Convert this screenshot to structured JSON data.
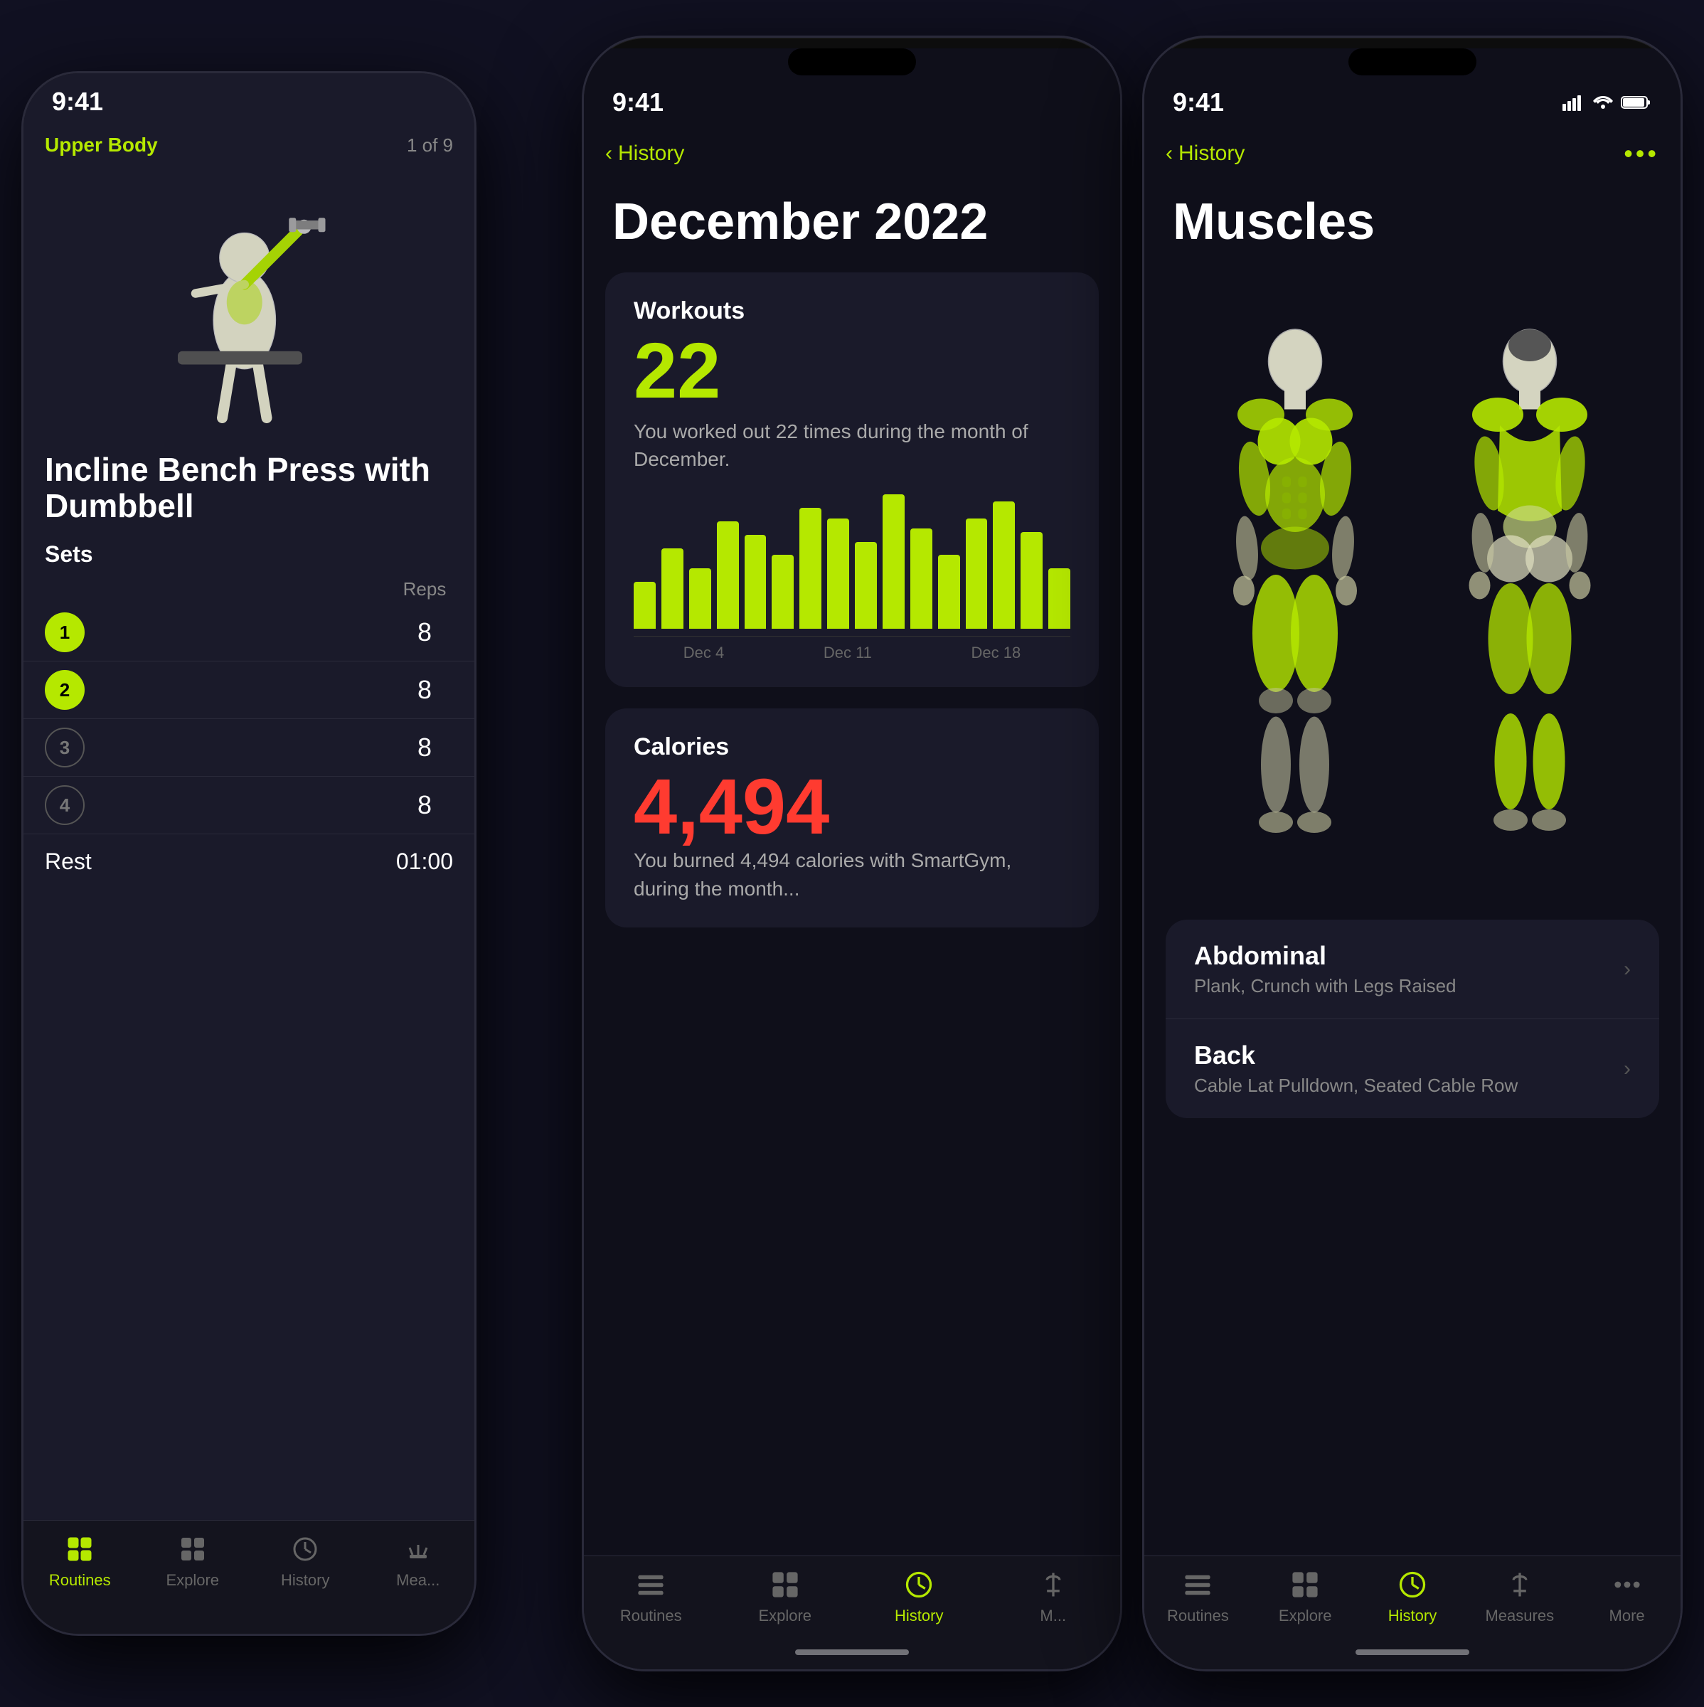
{
  "app": {
    "name": "SmartGym",
    "accent_color": "#b5e800",
    "background": "#0f0f1a"
  },
  "status_bar": {
    "time": "9:41",
    "signal": "●●●",
    "wifi": "wifi",
    "battery": "battery"
  },
  "left_phone": {
    "header": {
      "title": "Upper Body",
      "counter": "1 of 9"
    },
    "exercise_name": "Incline Bench Press with Dumbbell",
    "sets_label": "Sets",
    "reps_label": "Reps",
    "sets": [
      {
        "number": "1",
        "reps": "8",
        "active": true
      },
      {
        "number": "2",
        "reps": "8",
        "active": true
      },
      {
        "number": "3",
        "reps": "8",
        "active": false
      },
      {
        "number": "4",
        "reps": "8",
        "active": false
      }
    ],
    "rest_label": "Rest",
    "rest_time": "01:00",
    "tabs": [
      {
        "label": "Routines",
        "active": true
      },
      {
        "label": "Explore",
        "active": false
      },
      {
        "label": "History",
        "active": false
      },
      {
        "label": "Mea...",
        "active": false
      }
    ]
  },
  "center_phone": {
    "nav_back": "History",
    "month_title": "December 2022",
    "workouts_section": {
      "title": "Workouts",
      "number": "22",
      "description": "You worked out 22 times during the month of December."
    },
    "chart": {
      "bars": [
        4,
        7,
        5,
        9,
        8,
        6,
        10,
        9,
        7,
        11,
        8,
        6,
        9,
        12,
        8,
        5
      ],
      "labels": [
        "Dec 4",
        "Dec 11",
        "Dec 18"
      ]
    },
    "calories_section": {
      "title": "Calories",
      "number": "4,494",
      "description": "You burned 4,494 calories with SmartGym, during the month..."
    },
    "tabs": [
      {
        "label": "Routines",
        "active": false
      },
      {
        "label": "Explore",
        "active": false
      },
      {
        "label": "History",
        "active": true
      },
      {
        "label": "M...",
        "active": false
      }
    ]
  },
  "right_phone": {
    "nav_back": "History",
    "nav_more": "•••",
    "page_title": "Muscles",
    "muscle_groups": [
      {
        "name": "Abdominal",
        "exercises": "Plank, Crunch with Legs Raised"
      },
      {
        "name": "Back",
        "exercises": "Cable Lat Pulldown, Seated Cable Row"
      }
    ],
    "tabs": [
      {
        "label": "Routines",
        "active": false
      },
      {
        "label": "Explore",
        "active": false
      },
      {
        "label": "History",
        "active": true
      },
      {
        "label": "Measures",
        "active": false
      },
      {
        "label": "More",
        "active": false
      }
    ]
  }
}
